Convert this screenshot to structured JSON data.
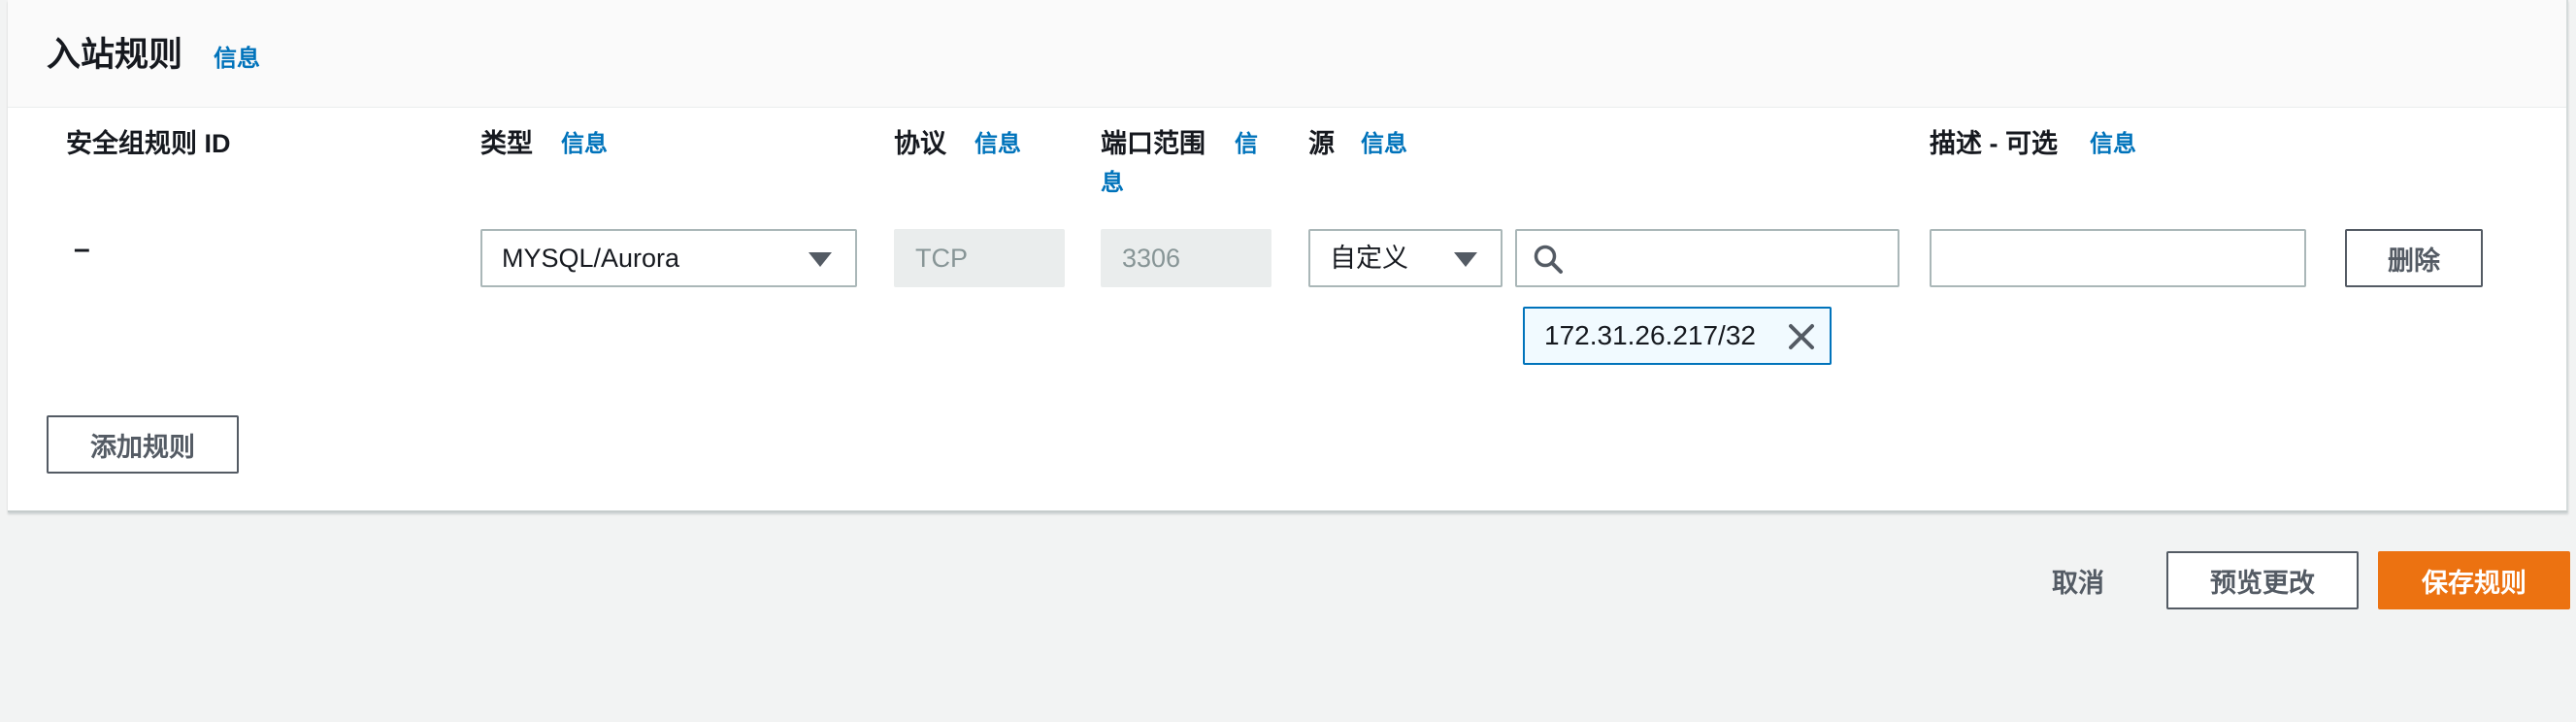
{
  "panel": {
    "title": "入站规则",
    "title_info": "信息"
  },
  "columns": {
    "rule_id": "安全组规则 ID",
    "type": "类型",
    "type_info": "信息",
    "protocol": "协议",
    "protocol_info": "信息",
    "port_range": "端口范围",
    "port_info_1": "信",
    "port_info_2": "息",
    "source": "源",
    "source_info": "信息",
    "description": "描述 - 可选",
    "description_info": "信息"
  },
  "rule": {
    "rule_id": "–",
    "type_value": "MYSQL/Aurora",
    "protocol_value": "TCP",
    "port_value": "3306",
    "source_type": "自定义",
    "source_search": "",
    "source_token": "172.31.26.217/32",
    "description_value": "",
    "delete_label": "删除"
  },
  "add_rule_label": "添加规则",
  "footer": {
    "cancel_label": "取消",
    "preview_label": "预览更改",
    "save_label": "保存规则"
  },
  "icons": {
    "search": "search-icon",
    "close": "close-icon",
    "caret": "caret-down-icon"
  },
  "colors": {
    "link": "#0073bb",
    "primary": "#ec7211",
    "token_border": "#0073bb",
    "token_bg": "#f1faff"
  }
}
